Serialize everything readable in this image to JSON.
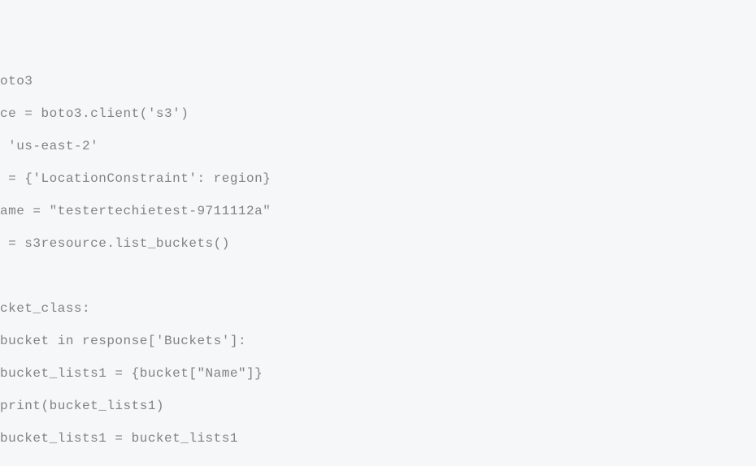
{
  "code": {
    "lines": [
      "oto3",
      "ce = boto3.client('s3')",
      " 'us-east-2'",
      " = {'LocationConstraint': region}",
      "ame = \"testertechietest-9711112a\"",
      " = s3resource.list_buckets()",
      "",
      "cket_class:",
      "bucket in response['Buckets']:",
      "bucket_lists1 = {bucket[\"Name\"]}",
      "print(bucket_lists1)",
      "bucket_lists1 = bucket_lists1"
    ]
  }
}
